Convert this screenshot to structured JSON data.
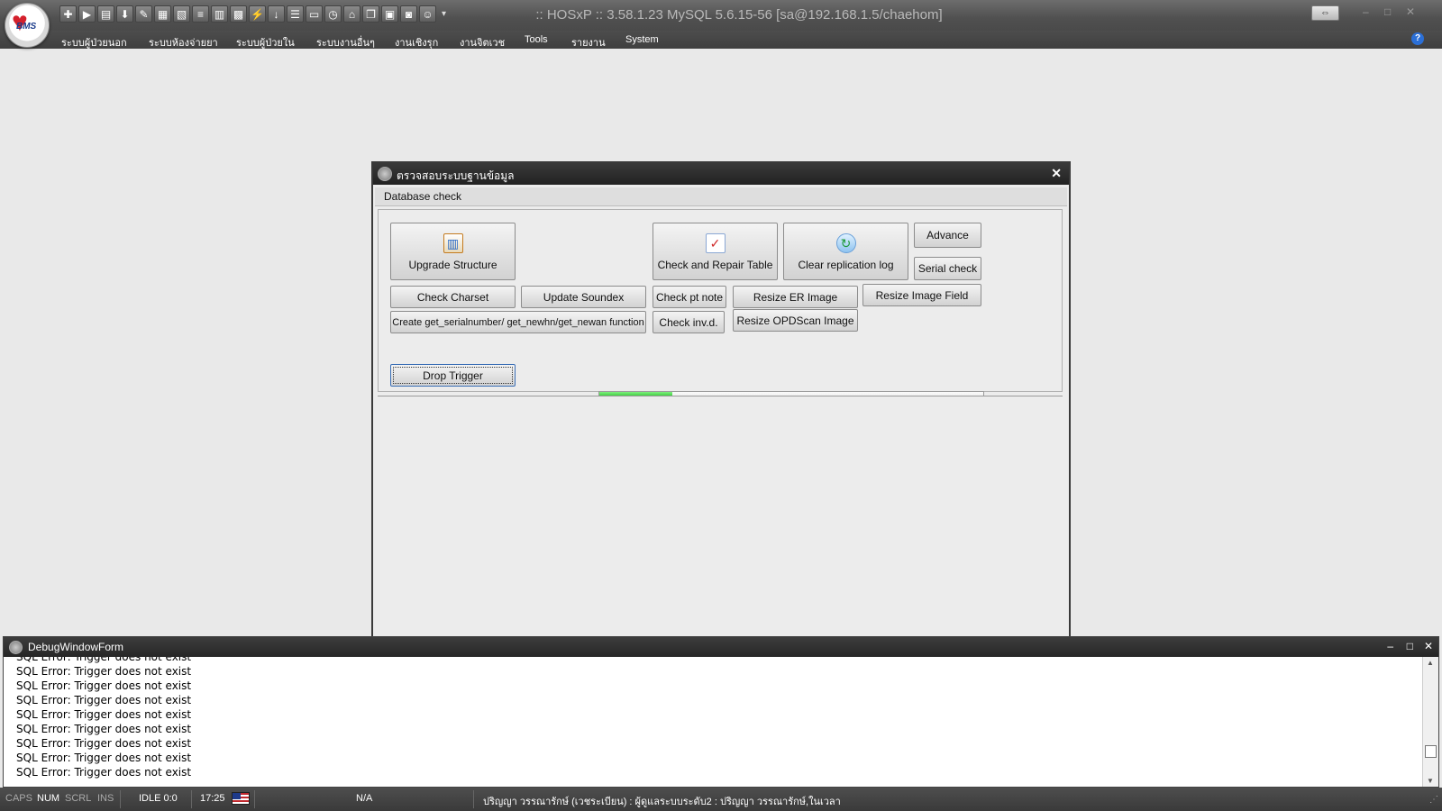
{
  "app": {
    "title": ":: HOSxP :: 3.58.1.23 MySQL 5.6.15-56 [sa@192.168.1.5/chaehom]",
    "logo_text": "BMS"
  },
  "quick_toolbar": {
    "icons": [
      "user-add-icon",
      "play-icon",
      "document-icon",
      "download-icon",
      "edit-icon",
      "form-icon",
      "report-icon",
      "list-icon",
      "table-icon",
      "grid-icon",
      "lightning-icon",
      "arrow-down-icon",
      "menu-icon",
      "monitor-icon",
      "clock-icon",
      "home-icon",
      "window-icon",
      "screen-icon",
      "camera-icon",
      "person-icon"
    ],
    "more_glyph": "▾"
  },
  "menu": {
    "items": [
      "ระบบผู้ป่วยนอก",
      "ระบบห้องจ่ายยา",
      "ระบบผู้ป่วยใน",
      "ระบบงานอื่นๆ",
      "งานเชิงรุก",
      "งานจิตเวช",
      "Tools",
      "รายงาน",
      "System"
    ]
  },
  "dialog": {
    "title": "ตรวจสอบระบบฐานข้อมูล",
    "close_glyph": "✕",
    "menu_label": "Database check",
    "buttons": {
      "upgrade_structure": "Upgrade Structure",
      "check_repair_table": "Check and Repair Table",
      "clear_replication_log": "Clear replication log",
      "advance": "Advance",
      "serial_check": "Serial check",
      "check_charset": "Check Charset",
      "update_soundex": "Update Soundex",
      "check_pt_note": "Check pt note",
      "resize_er_image": "Resize ER Image",
      "resize_image_field": "Resize Image Field",
      "create_functions": "Create get_serialnumber/ get_newhn/get_newan function",
      "check_inv_d": "Check inv.d.",
      "resize_opdscan_image": "Resize OPDScan Image",
      "drop_trigger": "Drop Trigger"
    },
    "progress_fraction": 0.19
  },
  "debug_window": {
    "title": "DebugWindowForm",
    "log_lines": [
      "SQL Error: Trigger does not exist",
      "SQL Error: Trigger does not exist",
      "SQL Error: Trigger does not exist",
      "SQL Error: Trigger does not exist",
      "SQL Error: Trigger does not exist",
      "SQL Error: Trigger does not exist",
      "SQL Error: Trigger does not exist",
      "SQL Error: Trigger does not exist",
      "SQL Error: Trigger does not exist"
    ]
  },
  "statusbar": {
    "caps": "CAPS",
    "num": "NUM",
    "scrl": "SCRL",
    "ins": "INS",
    "idle": "IDLE 0:0",
    "time": "17:25",
    "na": "N/A",
    "user_info": "ปริญญา  วรรณารักษ์ (เวชระเบียน) : ผู้ดูแลระบบระดับ2 : ปริญญา  วรรณารักษ์,ในเวลา"
  },
  "colors": {
    "progress": "#12b312",
    "titlebar": "#505050",
    "menubar": "#444444"
  }
}
